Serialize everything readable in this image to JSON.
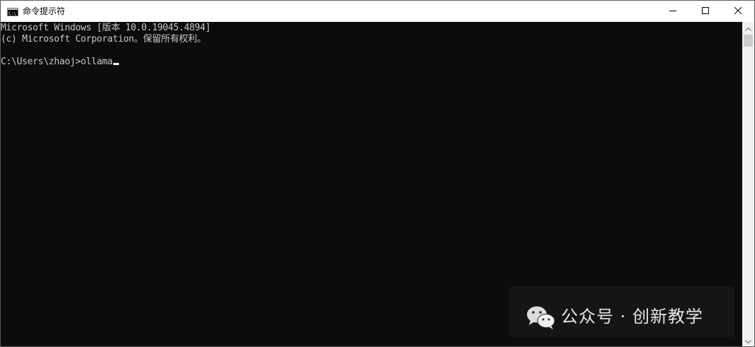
{
  "window": {
    "title": "命令提示符",
    "app_icon": "cmd-icon",
    "controls": {
      "minimize_icon": "minimize-icon",
      "maximize_icon": "maximize-icon",
      "close_icon": "close-icon"
    }
  },
  "console": {
    "lines": [
      "Microsoft Windows [版本 10.0.19045.4894]",
      "(c) Microsoft Corporation。保留所有权利。",
      ""
    ],
    "prompt": "C:\\Users\\zhaoj>",
    "input": "ollama",
    "background_color": "#0c0c0c",
    "text_color": "#c8c8c8"
  },
  "scrollbar": {
    "up_icon": "scroll-up-arrow-icon",
    "down_icon": "scroll-down-arrow-icon"
  },
  "watermark": {
    "logo": "wechat-icon",
    "text": "公众号 · 创新教学"
  }
}
